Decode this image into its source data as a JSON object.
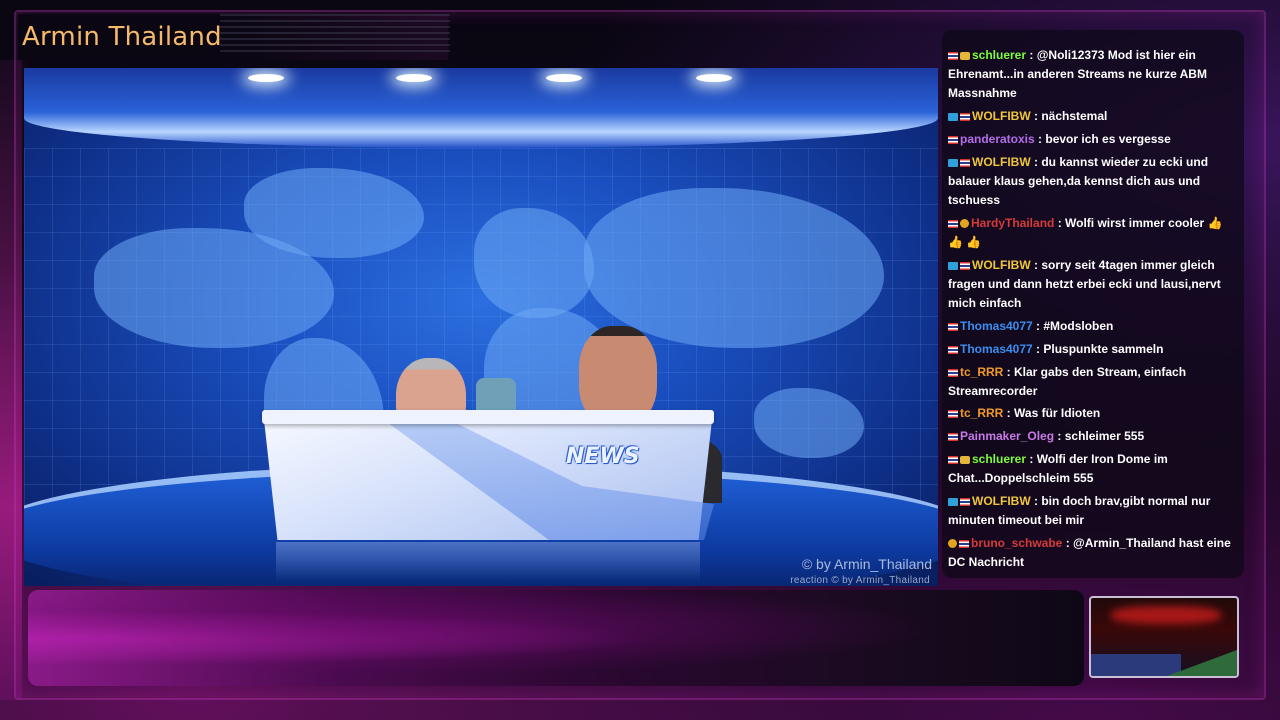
{
  "stream": {
    "title": "Armin Thailand"
  },
  "video": {
    "desk_label": "NEWS",
    "watermark": "© by Armin_Thailand",
    "watermark_small": "reaction  © by Armin_Thailand"
  },
  "chat": {
    "messages": [
      {
        "user": "schluerer",
        "text": " : @Noli12373 Mod ist hier ein Ehrenamt...in anderen Streams ne kurze ABM Massnahme",
        "color": "#7cfc3a",
        "badges": [
          "flag",
          "crown"
        ]
      },
      {
        "user": "WOLFIBW",
        "text": " : nächstemal",
        "color": "#f0c63a",
        "badges": [
          "vip",
          "flag"
        ]
      },
      {
        "user": "panderatoxis",
        "text": " : bevor ich es vergesse",
        "color": "#b56ee8",
        "badges": [
          "flag"
        ]
      },
      {
        "user": "WOLFIBW",
        "text": " : du kannst wieder zu ecki und balauer klaus gehen,da kennst dich aus und tschuess",
        "color": "#f0c63a",
        "badges": [
          "vip",
          "flag"
        ]
      },
      {
        "user": "HardyThailand",
        "text": " : Wolfi wirst immer cooler 👍 👍 👍",
        "color": "#d63a3a",
        "badges": [
          "flag",
          "warn"
        ]
      },
      {
        "user": "WOLFIBW",
        "text": " : sorry seit 4tagen immer gleich fragen und dann hetzt erbei ecki und lausi,nervt mich einfach",
        "color": "#f0c63a",
        "badges": [
          "vip",
          "flag"
        ]
      },
      {
        "user": "Thomas4077",
        "text": " : #Modsloben",
        "color": "#3a8ef0",
        "badges": [
          "flag"
        ]
      },
      {
        "user": "Thomas4077",
        "text": " : Pluspunkte sammeln",
        "color": "#3a8ef0",
        "badges": [
          "flag"
        ]
      },
      {
        "user": "tc_RRR",
        "text": " : Klar gabs den Stream, einfach Streamrecorder",
        "color": "#f09a2a",
        "badges": [
          "flag"
        ]
      },
      {
        "user": "tc_RRR",
        "text": " : Was für Idioten",
        "color": "#f09a2a",
        "badges": [
          "flag"
        ]
      },
      {
        "user": "Painmaker_Oleg",
        "text": " : schleimer 555",
        "color": "#c77ae8",
        "badges": [
          "flag"
        ]
      },
      {
        "user": "schluerer",
        "text": " : Wolfi der Iron Dome im Chat...Doppelschleim 555",
        "color": "#7cfc3a",
        "badges": [
          "flag",
          "crown"
        ]
      },
      {
        "user": "WOLFIBW",
        "text": " : bin doch brav,gibt normal nur minuten timeout bei mir",
        "color": "#f0c63a",
        "badges": [
          "vip",
          "flag"
        ]
      },
      {
        "user": "bruno_schwabe",
        "text": " : @Armin_Thailand hast eine DC Nachricht",
        "color": "#d63a3a",
        "badges": [
          "warn",
          "flag"
        ]
      }
    ]
  }
}
